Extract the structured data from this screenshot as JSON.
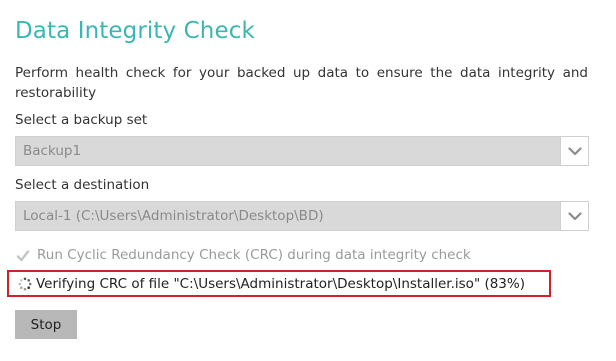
{
  "page": {
    "title": "Data Integrity Check",
    "description": "Perform health check for your backed up data to ensure the data integrity and restorability"
  },
  "backup_set": {
    "label": "Select a backup set",
    "selected": "Backup1"
  },
  "destination": {
    "label": "Select a destination",
    "selected": "Local-1 (C:\\Users\\Administrator\\Desktop\\BD)"
  },
  "crc_option": {
    "label": "Run Cyclic Redundancy Check (CRC) during data integrity check",
    "checked": true,
    "enabled": false
  },
  "status": {
    "text": "Verifying CRC of file \"C:\\Users\\Administrator\\Desktop\\Installer.iso\" (83%)",
    "progress_percent": 83,
    "highlight_color": "#d0202a"
  },
  "actions": {
    "stop_label": "Stop"
  },
  "theme": {
    "accent": "#3cb7b0",
    "button_bg": "#b8b8b8",
    "select_bg": "#d9d9d9"
  },
  "icons": {
    "dropdown": "chevron-down-icon",
    "checkbox": "checkmark-icon",
    "spinner": "loading-spinner-icon"
  }
}
